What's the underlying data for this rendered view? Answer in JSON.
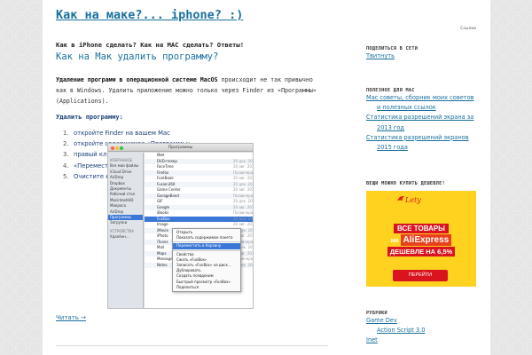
{
  "header": {
    "site_title": "Как на маке?... iphone? :)",
    "top_right": "Ссылки"
  },
  "post": {
    "tagline": "Как в iPhone сделать? Как на MAC сделать? Ответы!",
    "title": "Как на Мак удалить программу?",
    "intro_bold": "Удаление программ в операционной системе MacOS",
    "intro_rest": " происходит не так привычно как в Windows. Удалить приложение можно только через Finder из «Программы» (Applications).",
    "section_heading": "Удалить программу:",
    "steps": [
      {
        "num": "1.",
        "text": "откройте Finder на вашем Mac"
      },
      {
        "num": "2.",
        "text": "откройте содержимое «Программы»"
      },
      {
        "num": "3.",
        "text": "правый клик на нужном программе"
      },
      {
        "num": "4.",
        "text": "«Переместить в корзину» или Cmd+Delete"
      },
      {
        "num": "5.",
        "text": "Очистите корзину"
      }
    ],
    "read_more": "Читать →"
  },
  "screenshot": {
    "window_title": "Программы",
    "sidebar": [
      {
        "label": "ИЗБРАННОЕ",
        "group": true
      },
      {
        "label": "Все мои файлы"
      },
      {
        "label": "iCloud Drive"
      },
      {
        "label": "AirDrop"
      },
      {
        "label": "Dropbox"
      },
      {
        "label": "Документы"
      },
      {
        "label": "Рабочий стол"
      },
      {
        "label": "MacintoshHD"
      },
      {
        "label": "Макроса"
      },
      {
        "label": "AirDrop"
      },
      {
        "label": "Программы",
        "selected": true
      },
      {
        "label": "Загрузки"
      },
      {
        "label": "УСТРОЙСТВА",
        "group": true
      },
      {
        "label": "Удалённ..."
      }
    ],
    "files": [
      {
        "name": "Имя",
        "date": ""
      },
      {
        "name": "DVD-плеер",
        "date": "20 дек. 2014"
      },
      {
        "name": "FaceTime",
        "date": "20 авг. 2014"
      },
      {
        "name": "Firefox",
        "date": "Позавчера"
      },
      {
        "name": "FontBook",
        "date": "20 авг. 2014"
      },
      {
        "name": "Fusion360",
        "date": "20 дек. 2014"
      },
      {
        "name": "Game Center",
        "date": "20 авг. 2014"
      },
      {
        "name": "GarageBand",
        "date": "Позавчера"
      },
      {
        "name": "GIF",
        "date": "20 дек. 2014"
      },
      {
        "name": "Google",
        "date": "20 авг. 2014"
      },
      {
        "name": "iBooks",
        "date": "Позавчера"
      },
      {
        "name": "FunBox",
        "date": "20 дек. 2014",
        "selected": true
      },
      {
        "name": "Image",
        "date": "20 авг. 2014"
      },
      {
        "name": "iMovie",
        "date": "20 дек. 2014"
      },
      {
        "name": "iPhoto",
        "date": "20 авг. 2014"
      },
      {
        "name": "iTunes",
        "date": "Позавчера"
      },
      {
        "name": "Mail",
        "date": "20 дек. 2014"
      },
      {
        "name": "Maps",
        "date": "20 авг. 2014"
      },
      {
        "name": "Messages",
        "date": "Позавчера"
      },
      {
        "name": "Notes",
        "date": "20 дек. 2014"
      }
    ],
    "context_menu": [
      {
        "label": "Открыть"
      },
      {
        "label": "Показать содержимое пакета"
      },
      {
        "sep": true
      },
      {
        "label": "Переместить в Корзину",
        "selected": true
      },
      {
        "sep": true
      },
      {
        "label": "Свойства"
      },
      {
        "label": "Сжать «FunBox»"
      },
      {
        "label": "Записать «FunBox» на диск..."
      },
      {
        "label": "Дублировать"
      },
      {
        "label": "Создать псевдоним"
      },
      {
        "label": "Быстрый просмотр «FunBox»"
      },
      {
        "label": "Поделиться"
      }
    ]
  },
  "sidebar": {
    "share_title": "ПОДЕЛИТЬСЯ В СЕТИ",
    "share_link": "Твитнуть",
    "useful_title": "ПОЛЕЗНОЕ ДЛЯ MAC",
    "useful_links": [
      {
        "text": "Мас советы, сборник моих советов",
        "indent": false
      },
      {
        "text": "и полезных ссылок",
        "indent": true
      },
      {
        "text": "Статистика разрешений экрана за",
        "indent": false
      },
      {
        "text": "2013 год",
        "indent": true
      },
      {
        "text": "Статистика разрешений экранов",
        "indent": false
      },
      {
        "text": "2015 года",
        "indent": true
      }
    ],
    "deals_title": "ВЕЩИ МОЖНО КУПИТЬ ДЕШЕВЛЕ!",
    "banner": {
      "logo": "Lety",
      "line1": "ВСЕ ТОВАРЫ",
      "line2_pre": "на",
      "line2_brand": "AliExpress",
      "line3": "ДЕШЕВЛЕ НА 6,5%",
      "button": "ПЕРЕЙТИ"
    },
    "rubrics_title": "РУБРИКИ",
    "rubrics": [
      {
        "text": "Game Dev",
        "indent": false
      },
      {
        "text": "Action Script 3.0",
        "indent": true
      },
      {
        "text": "Inet",
        "indent": false
      }
    ]
  }
}
